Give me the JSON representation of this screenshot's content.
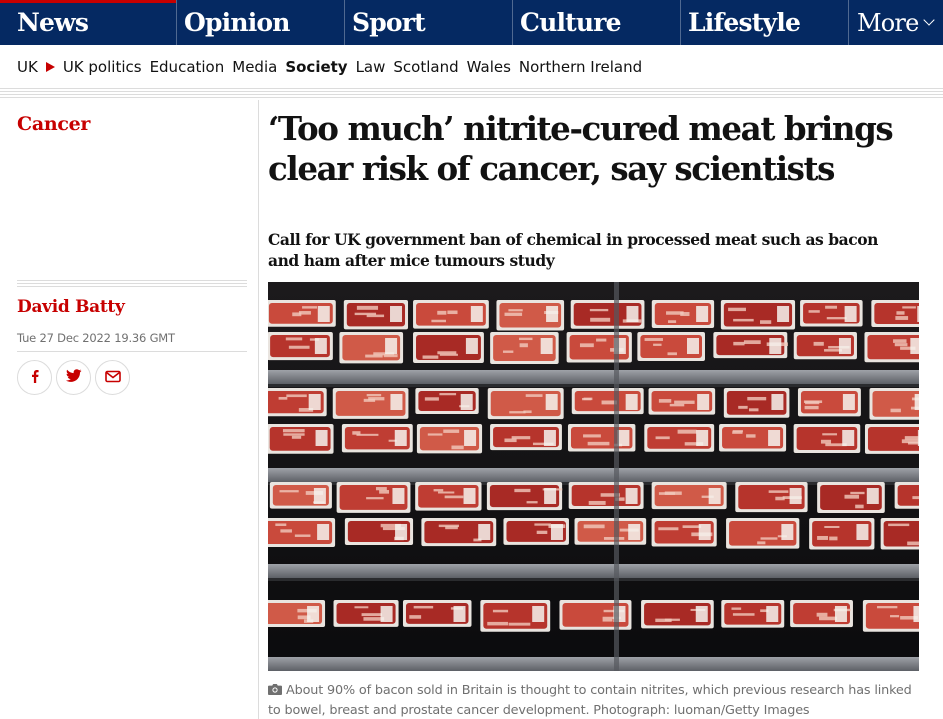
{
  "nav": {
    "pillars": [
      "News",
      "Opinion",
      "Sport",
      "Culture",
      "Lifestyle"
    ],
    "more_label": "More"
  },
  "subnav": {
    "uk": "UK",
    "items": [
      "UK politics",
      "Education",
      "Media",
      "Society",
      "Law",
      "Scotland",
      "Wales",
      "Northern Ireland"
    ],
    "active": "Society"
  },
  "article": {
    "section": "Cancer",
    "author": "David Batty",
    "date": "Tue 27 Dec 2022 19.36 GMT",
    "headline": "‘Too much’ nitrite-cured meat brings clear risk of cancer, say scientists",
    "standfirst": "Call for UK government ban of chemical in processed meat such as bacon and ham after mice tumours study",
    "caption": "About 90% of bacon sold in Britain is thought to contain nitrites, which previous research has linked to bowel, breast and prostate cancer development. Photograph: luoman/Getty Images"
  },
  "share": {
    "icons": [
      "facebook-icon",
      "twitter-icon",
      "email-icon"
    ]
  },
  "colors": {
    "brand_navy": "#052962",
    "news_red": "#c70000",
    "text": "#121212",
    "muted": "#707070"
  }
}
